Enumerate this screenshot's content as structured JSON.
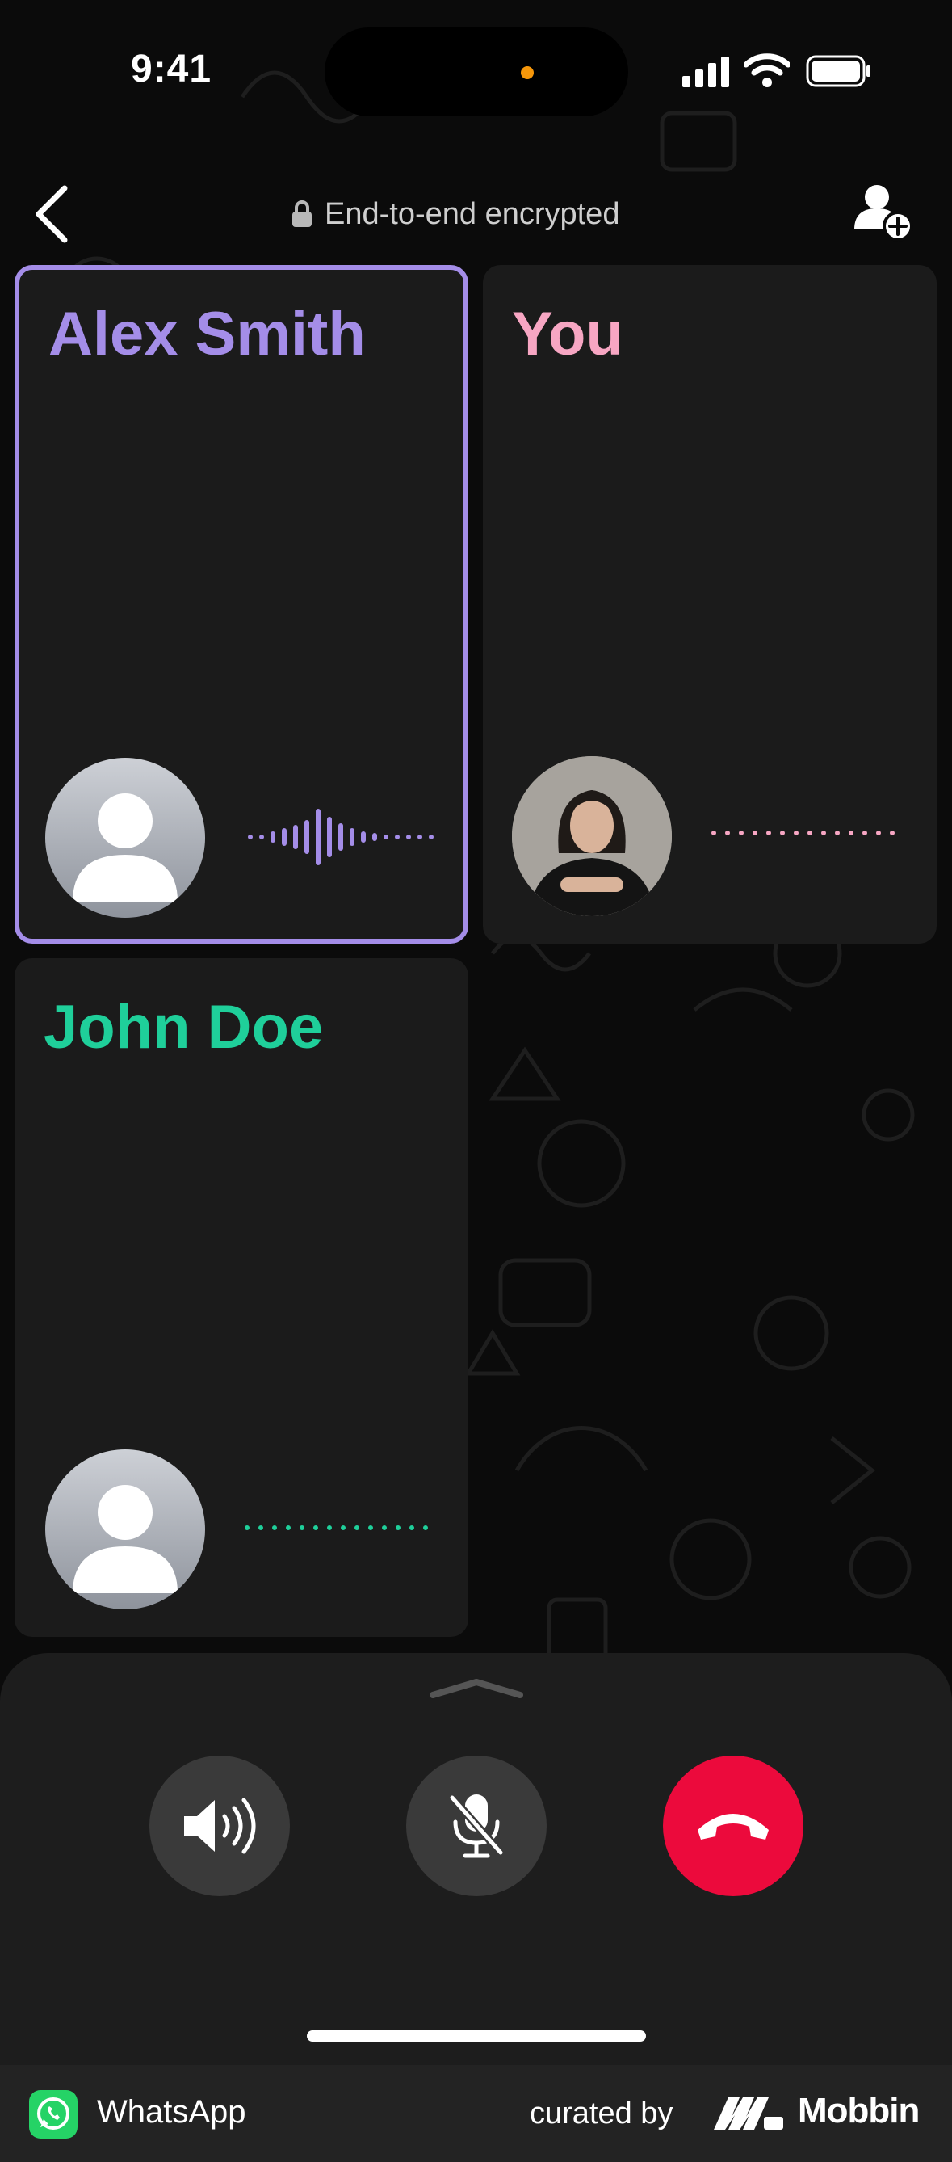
{
  "status_bar": {
    "time": "9:41",
    "icons": [
      "cellular-signal-icon",
      "wifi-icon",
      "battery-icon"
    ]
  },
  "header": {
    "back_icon": "chevron-left-icon",
    "encryption_icon": "lock-icon",
    "encryption_label": "End-to-end encrypted",
    "add_participant_icon": "add-person-icon"
  },
  "participants": [
    {
      "name": "Alex Smith",
      "color": "#a48de8",
      "speaking": true,
      "avatar": "default-avatar-icon",
      "audio": "speaking-waveform"
    },
    {
      "name": "You",
      "color": "#f7a6c3",
      "speaking": false,
      "avatar": "profile-photo",
      "audio": "idle-dotted-line"
    },
    {
      "name": "John Doe",
      "color": "#1fcf9a",
      "speaking": false,
      "avatar": "default-avatar-icon",
      "audio": "idle-dotted-line"
    }
  ],
  "controls": {
    "expand_icon": "chevron-up-icon",
    "speaker": {
      "icon": "speaker-icon",
      "color": "#3a3a3a"
    },
    "mute": {
      "icon": "microphone-muted-icon",
      "color": "#3a3a3a"
    },
    "end_call": {
      "icon": "end-call-icon",
      "color": "#ec0a3c"
    }
  },
  "footer": {
    "app_name": "WhatsApp",
    "curated_by": "curated by",
    "brand": "Mobbin"
  }
}
